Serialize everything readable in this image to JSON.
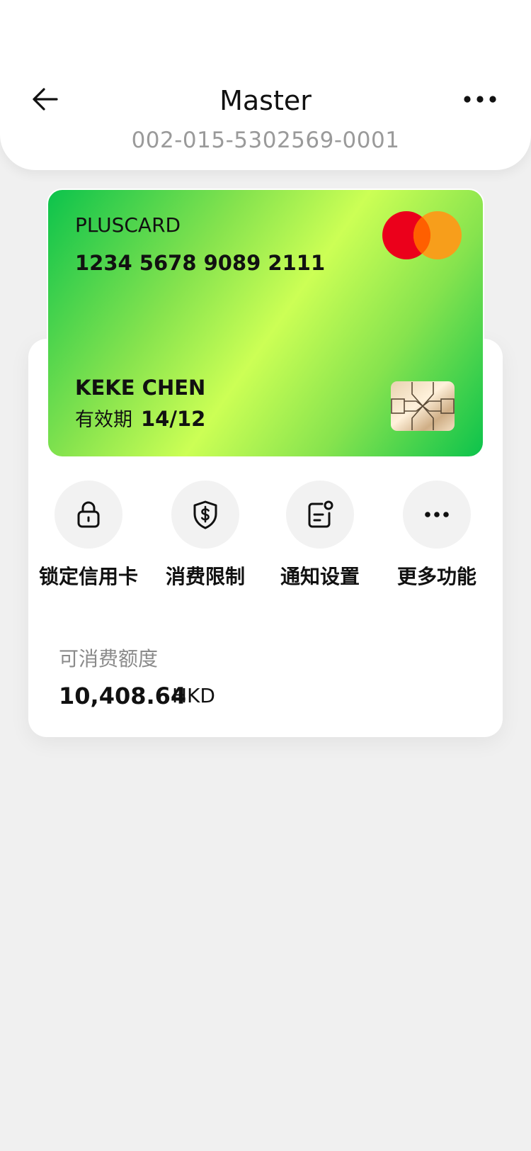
{
  "header": {
    "title": "Master",
    "account_number": "002-015-5302569-0001",
    "back_icon": "arrow-left-icon",
    "more_icon": "more-horizontal-icon"
  },
  "card": {
    "brand": "PLUSCARD",
    "number": "1234 5678 9089 2111",
    "holder": "KEKE CHEN",
    "expiry_label": "有效期",
    "expiry_value": "14/12",
    "network_icon": "mastercard-logo-icon",
    "chip_icon": "card-chip-icon",
    "gradient_colors": [
      "#0cc34c",
      "#ccff55"
    ]
  },
  "actions": [
    {
      "label": "锁定信用卡",
      "icon": "lock-icon"
    },
    {
      "label": "消费限制",
      "icon": "shield-dollar-icon"
    },
    {
      "label": "通知设置",
      "icon": "notification-settings-icon"
    },
    {
      "label": "更多功能",
      "icon": "more-horizontal-icon"
    }
  ],
  "balance": {
    "label": "可消费额度",
    "amount": "10,408.64",
    "currency": "HKD"
  },
  "colors": {
    "background": "#f0f0f0",
    "surface": "#ffffff",
    "muted_text": "#9a9a9a",
    "mastercard_red": "#eb001b",
    "mastercard_orange": "#f79e1b"
  }
}
